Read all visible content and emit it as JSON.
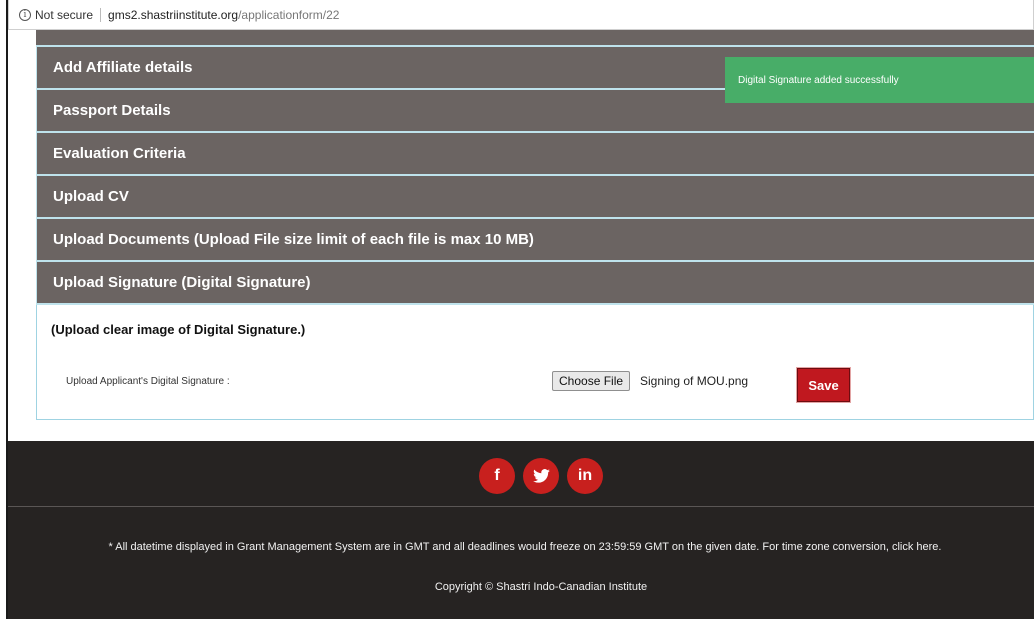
{
  "browser": {
    "info_icon": "info-icon",
    "secure_label": "Not secure",
    "url_host": "gms2.shastriinstitute.org",
    "url_path": "/applicationform/22"
  },
  "sections": [
    {
      "label": "Add Affiliate details"
    },
    {
      "label": "Passport Details"
    },
    {
      "label": "Evaluation Criteria"
    },
    {
      "label": "Upload CV"
    },
    {
      "label": "Upload Documents (Upload File size limit of each file is max 10 MB)"
    },
    {
      "label": "Upload Signature (Digital Signature)"
    }
  ],
  "signature": {
    "instruction": "(Upload clear image of Digital Signature.)",
    "field_label": "Upload Applicant's Digital Signature :",
    "choose_file_label": "Choose File",
    "file_name": "Signing of MOU.png",
    "save_label": "Save"
  },
  "toast": {
    "message": "Digital Signature added successfully",
    "color": "#48ad68"
  },
  "footer": {
    "social": [
      {
        "icon": "facebook-icon",
        "glyph": "f"
      },
      {
        "icon": "twitter-icon",
        "glyph": "ὂ6"
      },
      {
        "icon": "linkedin-icon",
        "glyph": "in"
      }
    ],
    "note": "* All datetime displayed in Grant Management System are in GMT and all deadlines would freeze on 23:59:59 GMT on the given date. For time zone conversion, click here.",
    "copyright": "Copyright © Shastri Indo-Canadian Institute"
  },
  "colors": {
    "section_header": "#6b6462",
    "save_button": "#c0181f",
    "social_icon": "#c8201e",
    "footer_bg": "#262322"
  }
}
